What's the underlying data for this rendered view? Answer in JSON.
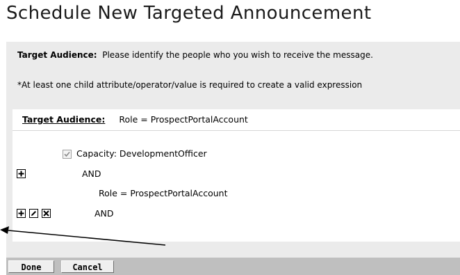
{
  "page": {
    "title": "Schedule New Targeted Announcement"
  },
  "intro": {
    "target_label": "Target Audience:",
    "target_text": "Please identify the people who you wish to receive the message.",
    "note": "*At least one child attribute/operator/value is required to create a valid expression"
  },
  "expression": {
    "header_label": "Target Audience:",
    "header_value": "Role = ProspectPortalAccount",
    "rows": [
      {
        "text": "Capacity: DevelopmentOfficer",
        "checked": true
      },
      {
        "text": "AND"
      },
      {
        "text": "Role = ProspectPortalAccount"
      },
      {
        "text": "AND"
      }
    ]
  },
  "icons": [
    "checkbox-icon",
    "add-icon",
    "edit-icon",
    "delete-icon",
    "arrow-annotation"
  ],
  "footer": {
    "done_label": "Done",
    "cancel_label": "Cancel"
  },
  "colors": {
    "panel_bg": "#ebebeb",
    "footer_bg": "#bfbfbf",
    "button_bg": "#efefef"
  }
}
